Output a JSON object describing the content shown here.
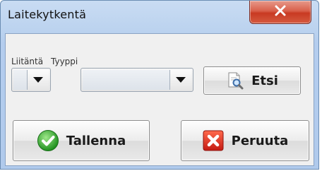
{
  "window": {
    "title": "Laitekytkentä",
    "close_icon": "close-x-icon"
  },
  "form": {
    "liitanta_label": "Liitäntä",
    "tyyppi_label": "Tyyppi",
    "liitanta_value": "",
    "tyyppi_value": ""
  },
  "buttons": {
    "search_label": "Etsi",
    "save_label": "Tallenna",
    "cancel_label": "Peruuta"
  },
  "colors": {
    "titlebar": "#bcd3ef",
    "close_button": "#c83a22",
    "save_icon": "#2aa12a",
    "cancel_icon": "#d8261c"
  }
}
